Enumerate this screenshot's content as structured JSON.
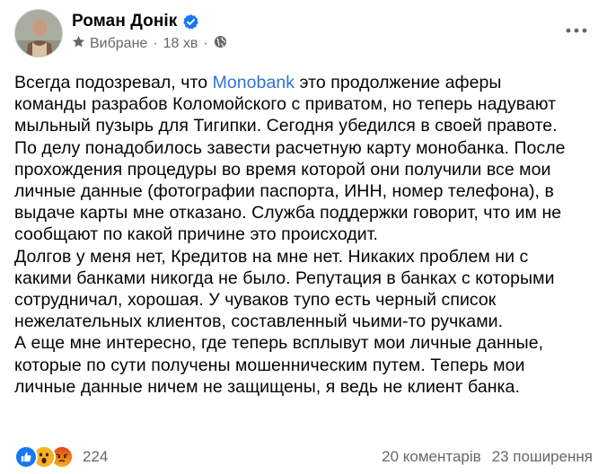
{
  "post": {
    "author": "Роман Донік",
    "verified_icon": "verified-badge",
    "meta": {
      "favorites_icon": "star-icon",
      "favorites_label": "Вибране",
      "separator": "·",
      "time": "18 хв",
      "audience_icon": "globe-icon"
    },
    "more_icon": "more-horizontal-icon",
    "body_lines": [
      {
        "before": "Всегда подозревал, что ",
        "link": "Monobank",
        "after": " это продолжение аферы"
      },
      {
        "text": "команды разрабов Коломойского с приватом, но теперь надувают"
      },
      {
        "text": "мыльный пузырь для Тигипки. Сегодня убедился в своей правоте."
      },
      {
        "text": "По делу понадобилось завести расчетную карту монобанка. После"
      },
      {
        "text": "прохождения процедуры во время которой они получили все мои"
      },
      {
        "text": "личные данные (фотографии паспорта, ИНН, номер телефона), в"
      },
      {
        "text": "выдаче карты мне отказано. Служба поддержки говорит, что им не"
      },
      {
        "text": "сообщают по какой причине это происходит."
      },
      {
        "text": "Долгов у меня нет, Кредитов на мне нет. Никаких проблем ни с"
      },
      {
        "text": "какими банками никогда не было. Репутация в банках с которыми"
      },
      {
        "text": "сотрудничал, хорошая. У чуваков тупо есть черный список"
      },
      {
        "text": "нежелательных клиентов, составленный чьими-то ручками."
      },
      {
        "text": "А еще мне интересно, где теперь всплывут мои личные данные,"
      },
      {
        "text": "которые по сути получены мошенническим путем. Теперь мои"
      },
      {
        "text": "личные данные ничем не защищены, я ведь не клиент банка."
      }
    ],
    "reactions": {
      "icons": [
        "like-reaction-icon",
        "wow-reaction-icon",
        "angry-reaction-icon"
      ],
      "count": "224",
      "comments": "20 коментарів",
      "shares": "23 поширення"
    },
    "colors": {
      "link": "#2e72d2",
      "secondary_text": "#65676b",
      "verified": "#1877f2",
      "like": "#1877f2",
      "wow": "#f7b125",
      "angry": "#e9710f"
    }
  }
}
